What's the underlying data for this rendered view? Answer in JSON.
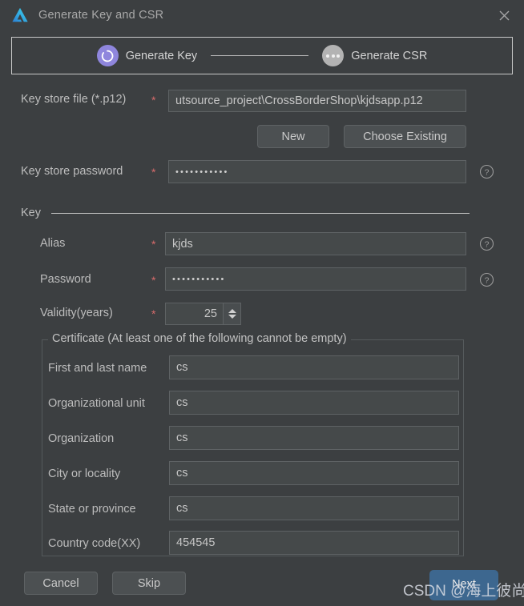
{
  "window": {
    "title": "Generate Key and CSR",
    "logo_icon": "android-studio-logo-icon",
    "close_icon": "close-icon"
  },
  "wizard": {
    "steps": [
      {
        "label": "Generate Key",
        "state": "active",
        "icon": "spinner-ring-icon"
      },
      {
        "label": "Generate CSR",
        "state": "inactive",
        "icon": "ellipsis-icon"
      }
    ]
  },
  "form": {
    "keystore_file": {
      "label": "Key store file (*.p12)",
      "required_marker": "*",
      "value": "utsource_project\\CrossBorderShop\\kjdsapp.p12"
    },
    "new_button": "New",
    "choose_existing_button": "Choose Existing",
    "keystore_password": {
      "label": "Key store password",
      "required_marker": "*",
      "value": "•••••••••••",
      "help_icon": "help-circle-icon"
    }
  },
  "key_section": {
    "title": "Key",
    "alias": {
      "label": "Alias",
      "required_marker": "*",
      "value": "kjds",
      "help_icon": "help-circle-icon"
    },
    "password": {
      "label": "Password",
      "required_marker": "*",
      "value": "•••••••••••",
      "help_icon": "help-circle-icon"
    },
    "validity": {
      "label": "Validity(years)",
      "required_marker": "*",
      "value": "25",
      "stepper_icon": "spinner-arrows-icon"
    }
  },
  "certificate": {
    "legend": "Certificate (At least one of the following cannot be empty)",
    "fields": [
      {
        "label": "First and last name",
        "value": "cs"
      },
      {
        "label": "Organizational unit",
        "value": "cs"
      },
      {
        "label": "Organization",
        "value": "cs"
      },
      {
        "label": "City or locality",
        "value": "cs"
      },
      {
        "label": "State or province",
        "value": "cs"
      },
      {
        "label": "Country code(XX)",
        "value": "454545"
      }
    ]
  },
  "footer": {
    "cancel": "Cancel",
    "skip": "Skip",
    "next": "Next"
  },
  "watermark": "CSDN @海上彼尚",
  "colors": {
    "background": "#3c3f41",
    "field_background": "#45494a",
    "accent_step_active": "#8f86dd",
    "accent_primary_button": "#3d678f",
    "required_marker": "#d66b6b"
  }
}
